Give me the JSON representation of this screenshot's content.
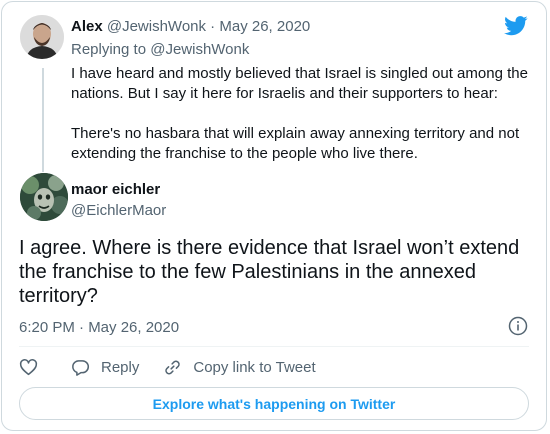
{
  "parent_tweet": {
    "author_name": "Alex",
    "author_handle": "@JewishWonk",
    "separator": " · ",
    "date": "May 26, 2020",
    "replying_label": "Replying to ",
    "replying_handle": "@JewishWonk",
    "paragraphs": [
      "I have heard and mostly believed that Israel is singled out among the nations. But I say it here for Israelis and their supporters to hear:",
      "There's no hasbara that will explain away annexing territory and not extending the franchise to the people who live there."
    ]
  },
  "main_tweet": {
    "author_name": "maor eichler",
    "author_handle": "@EichlerMaor",
    "text": "I agree. Where is there evidence that Israel won’t extend the franchise to the few Palestinians in the annexed territory?",
    "timestamp": "6:20 PM · May 26, 2020"
  },
  "actions": {
    "reply_label": "Reply",
    "copy_link_label": "Copy link to Tweet"
  },
  "explore_label": "Explore what's happening on Twitter",
  "icons": {
    "brand": "twitter-bird-icon",
    "info": "info-icon",
    "like": "heart-icon",
    "reply": "speech-bubble-icon",
    "link": "link-icon"
  },
  "colors": {
    "accent": "#1d9bf0",
    "text": "#0f1419",
    "muted": "#536471",
    "border": "#cfd9de"
  }
}
